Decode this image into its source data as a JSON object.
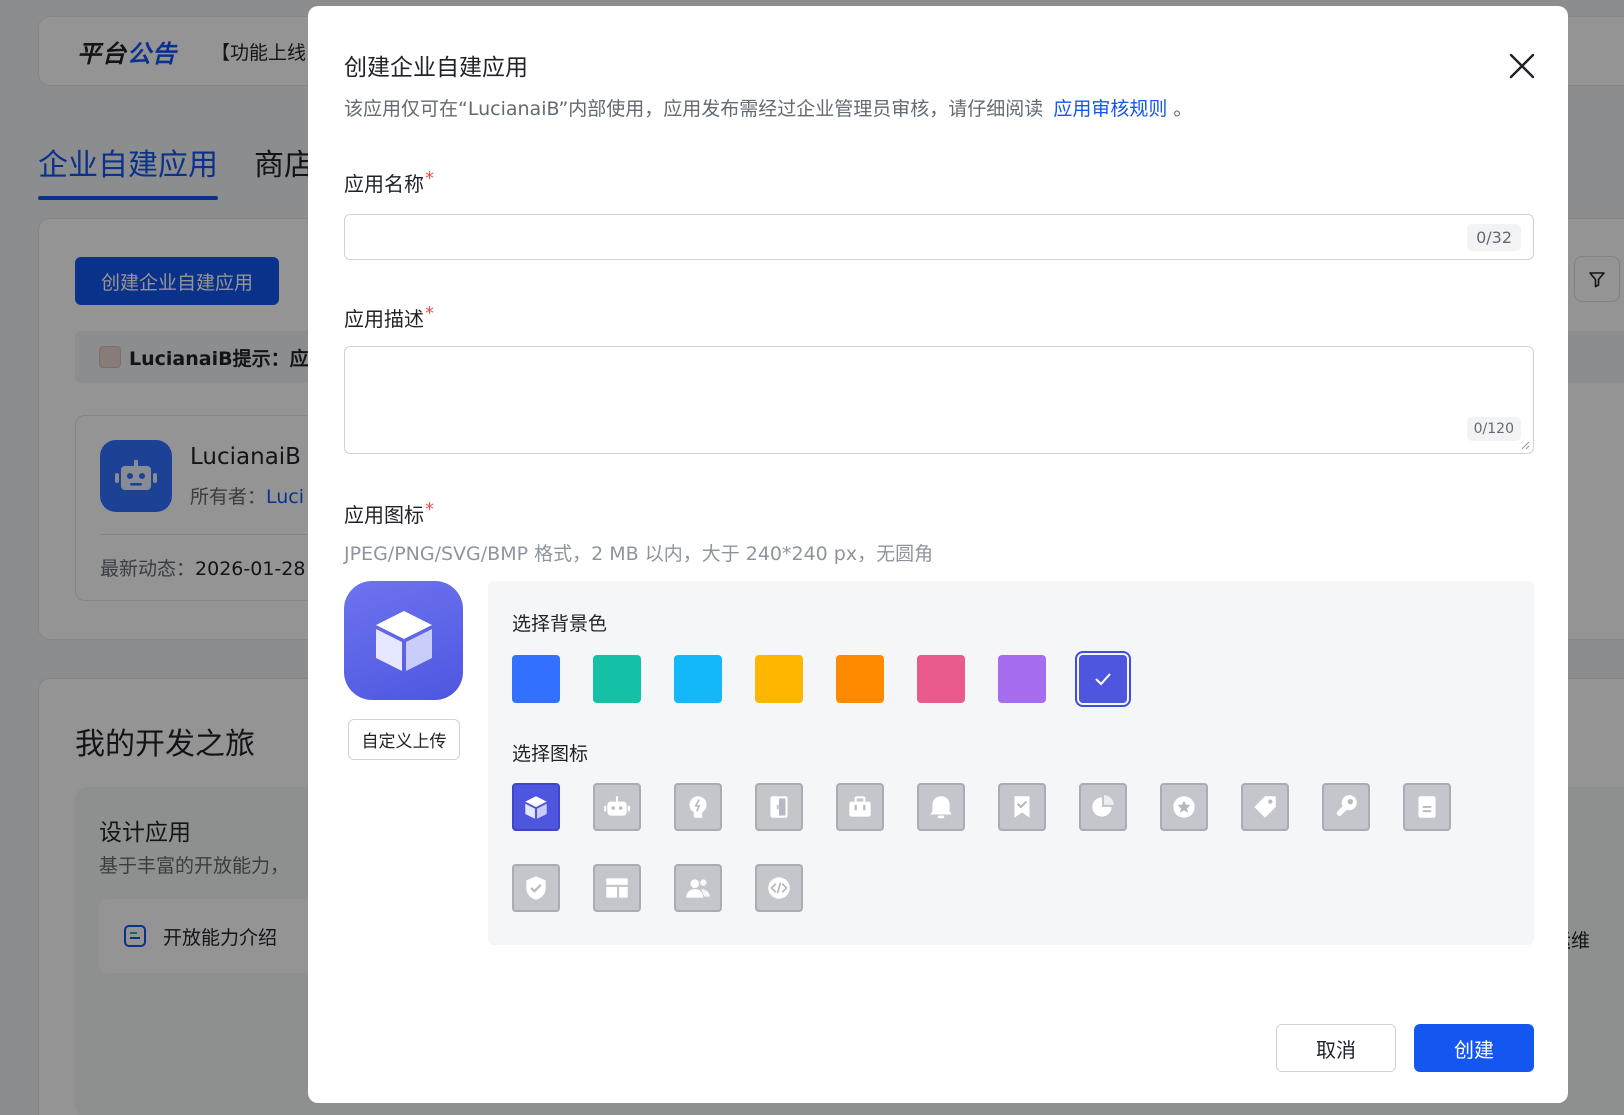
{
  "background": {
    "notice": {
      "title_black": "平台",
      "title_blue": "公告",
      "text": "【功能上线"
    },
    "tabs": [
      {
        "label": "企业自建应用",
        "active": true
      },
      {
        "label": "商店"
      }
    ],
    "create_button": "创建企业自建应用",
    "tip": "LucianaiB提示：应",
    "app_card": {
      "name": "LucianaiB",
      "owner_label": "所有者：",
      "owner_value": "Luci",
      "latest_label": "最新动态：",
      "latest_value": "2026-01-28"
    },
    "journey": {
      "title": "我的开发之旅",
      "design_title": "设计应用",
      "design_desc": "基于丰富的开放能力，",
      "capability_item": "开放能力介绍",
      "ops_item": "运维"
    }
  },
  "modal": {
    "title": "创建企业自建应用",
    "subtitle": "该应用仅可在“LucianaiB”内部使用，应用发布需经过企业管理员审核，请仔细阅读",
    "subtitle_link": "应用审核规则",
    "subtitle_end": " 。",
    "name_label": "应用名称",
    "name_value": "",
    "name_counter": "0/32",
    "desc_label": "应用描述",
    "desc_value": "",
    "desc_counter": "0/120",
    "icon_label": "应用图标",
    "required_mark": "*",
    "icon_hint": "JPEG/PNG/SVG/BMP 格式，2 MB 以内，大于 240*240 px，无圆角",
    "upload_button": "自定义上传",
    "bg_color_label": "选择背景色",
    "bg_colors": [
      "#3370ff",
      "#14c0a6",
      "#13b8f8",
      "#ffb600",
      "#ff8a00",
      "#ea5a8e",
      "#a66df0",
      "#4e56e0"
    ],
    "selected_color_index": 7,
    "icon_select_label": "选择图标",
    "icons": [
      "cube-icon",
      "robot-icon",
      "lightbulb-icon",
      "document-open-icon",
      "briefcase-icon",
      "bell-icon",
      "bookmark-check-icon",
      "pie-chart-icon",
      "star-icon",
      "tag-icon",
      "wrench-icon",
      "file-icon",
      "shield-check-icon",
      "layout-icon",
      "users-icon",
      "code-icon"
    ],
    "selected_icon_index": 0,
    "cancel_button": "取消",
    "create_button": "创建"
  }
}
